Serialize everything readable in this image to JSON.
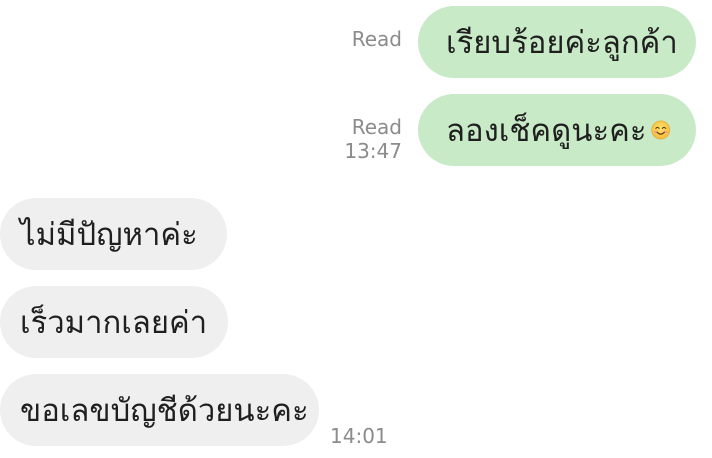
{
  "messages": [
    {
      "side": "sent",
      "text": "เรียบร้อยค่ะลูกค้า",
      "status": "Read",
      "time": ""
    },
    {
      "side": "sent",
      "text": "ลองเช็คดูนะคะ",
      "emoji": "smiling-face-icon",
      "status": "Read",
      "time": "13:47"
    },
    {
      "side": "received",
      "text": "ไม่มีปัญหาค่ะ",
      "time": ""
    },
    {
      "side": "received",
      "text": "เร็วมากเลยค่า",
      "time": ""
    },
    {
      "side": "received",
      "text": "ขอเลขบัญชีด้วยนะคะ",
      "time": "14:01"
    }
  ],
  "colors": {
    "sent_bubble": "#c8eac6",
    "received_bubble": "#efefef",
    "meta_text": "#8b8b8b"
  }
}
